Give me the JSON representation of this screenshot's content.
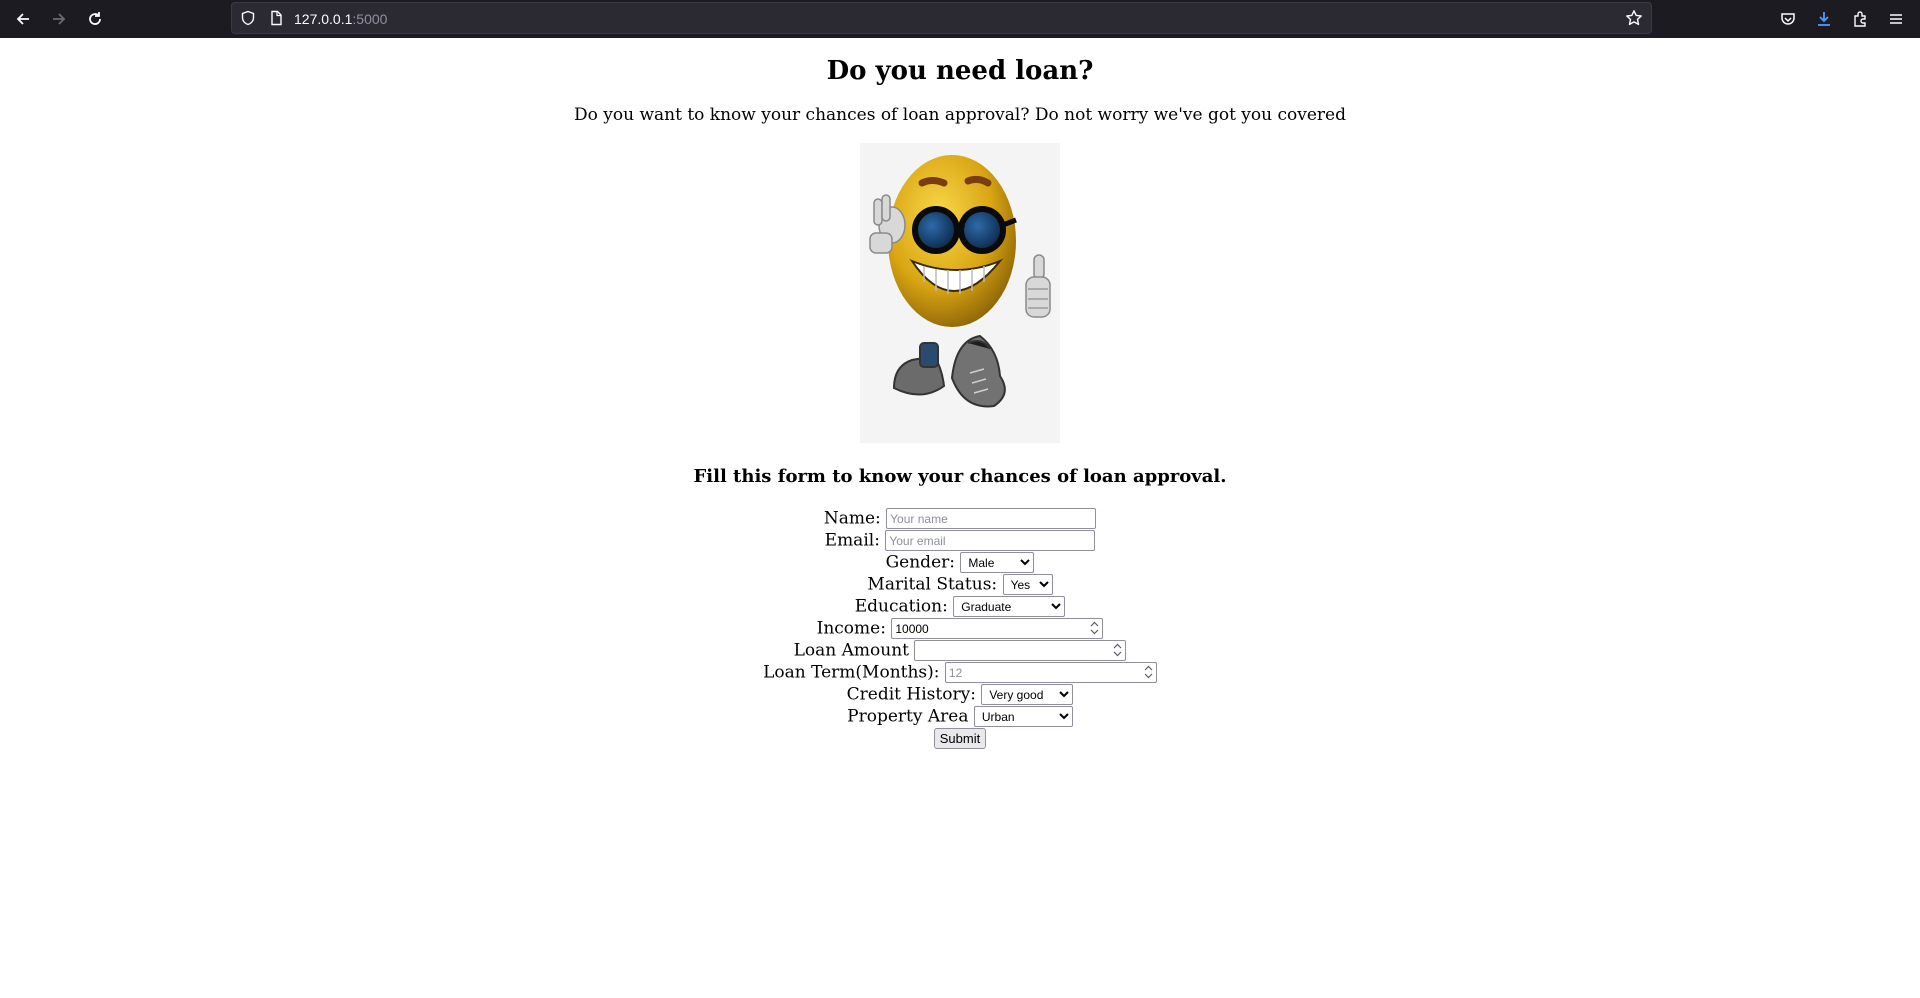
{
  "browser": {
    "url_host": "127.0.0.1",
    "url_port": ":5000",
    "icons": [
      "back-icon",
      "forward-icon",
      "reload-icon",
      "shield-icon",
      "page-icon",
      "bookmark-star-icon",
      "pocket-icon",
      "downloads-icon",
      "extensions-icon",
      "menu-icon"
    ]
  },
  "page": {
    "title": "Do you need loan?",
    "subtitle": "Do you want to know your chances of loan approval? Do not worry we've got you covered",
    "form_heading": "Fill this form to know your chances of loan approval."
  },
  "form": {
    "name": {
      "label": "Name:",
      "placeholder": "Your name",
      "value": ""
    },
    "email": {
      "label": "Email:",
      "placeholder": "Your email",
      "value": ""
    },
    "gender": {
      "label": "Gender:",
      "selected": "Male"
    },
    "marital": {
      "label": "Marital Status:",
      "selected": "Yes"
    },
    "education": {
      "label": "Education:",
      "selected": "Graduate"
    },
    "income": {
      "label": "Income:",
      "value": "10000"
    },
    "loan_amount": {
      "label": "Loan Amount",
      "value": ""
    },
    "loan_term": {
      "label": "Loan Term(Months):",
      "placeholder": "12"
    },
    "credit": {
      "label": "Credit History:",
      "selected": "Very good"
    },
    "property": {
      "label": "Property Area",
      "selected": "Urban"
    },
    "submit_label": "Submit"
  },
  "colors": {
    "toolbar": "#1c1b22",
    "urlbar": "#2b2a33",
    "download_accent": "#4c9bff"
  }
}
